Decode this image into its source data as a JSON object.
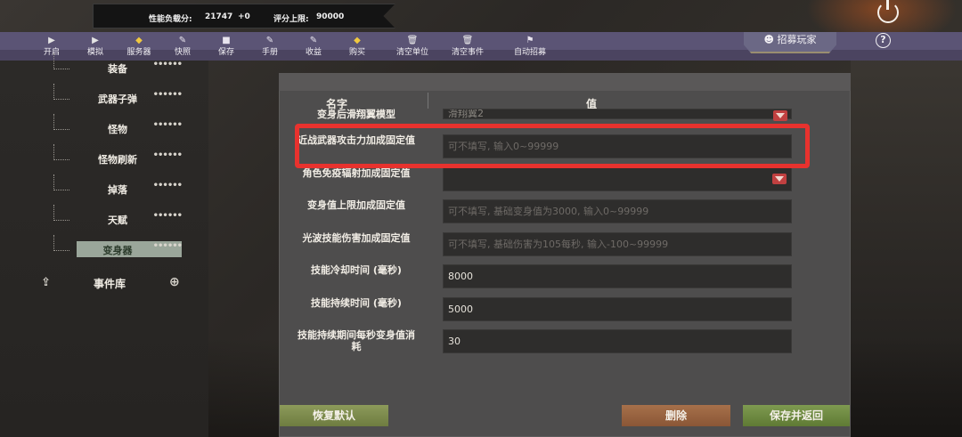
{
  "stats": {
    "load_label": "性能负载分:",
    "load_value": "21747",
    "load_delta": "+0",
    "score_label": "评分上限:",
    "score_value": "90000"
  },
  "toolbar": {
    "items": [
      {
        "label": "开启",
        "icon": "play-icon"
      },
      {
        "label": "模拟",
        "icon": "play-icon"
      },
      {
        "label": "服务器",
        "icon": "box-icon"
      },
      {
        "label": "快照",
        "icon": "edit-icon"
      },
      {
        "label": "保存",
        "icon": "file-icon"
      },
      {
        "label": "手册",
        "icon": "edit-icon"
      },
      {
        "label": "收益",
        "icon": "edit-icon"
      },
      {
        "label": "购买",
        "icon": "box-icon"
      },
      {
        "label": "清空单位",
        "icon": "trash-icon"
      },
      {
        "label": "清空事件",
        "icon": "trash-icon"
      },
      {
        "label": "自动招募",
        "icon": "flag-icon"
      }
    ],
    "recruit_label": "招募玩家",
    "help_label": "?"
  },
  "sidebar": {
    "items": [
      {
        "label": "装备",
        "dots": "••••••"
      },
      {
        "label": "武器子弹",
        "dots": "••••••"
      },
      {
        "label": "怪物",
        "dots": "••••••"
      },
      {
        "label": "怪物刷新",
        "dots": "••••••"
      },
      {
        "label": "掉落",
        "dots": "••••••"
      },
      {
        "label": "天赋",
        "dots": "••••••"
      },
      {
        "label": "变身器",
        "dots": "••••••",
        "active": true
      }
    ],
    "event_lib_label": "事件库"
  },
  "panel": {
    "col_name": "名字",
    "col_value": "值",
    "rows": [
      {
        "label": "变身后滑翔翼模型",
        "value": "滑翔翼2",
        "type": "dropdown"
      },
      {
        "label": "近战武器攻击力加成固定值",
        "value": "",
        "placeholder": "可不填写, 输入0~99999",
        "type": "input"
      },
      {
        "label": "角色免疫辐射加成固定值",
        "value": "",
        "type": "dropdown"
      },
      {
        "label": "变身值上限加成固定值",
        "value": "",
        "placeholder": "可不填写, 基础变身值为3000, 输入0~99999",
        "type": "input"
      },
      {
        "label": "光波技能伤害加成固定值",
        "value": "",
        "placeholder": "可不填写, 基础伤害为105每秒, 输入-100~99999",
        "type": "input"
      },
      {
        "label": "技能冷却时间 (毫秒)",
        "value": "8000",
        "type": "input"
      },
      {
        "label": "技能持续时间 (毫秒)",
        "value": "5000",
        "type": "input"
      },
      {
        "label": "技能持续期间每秒变身值消耗",
        "value": "30",
        "type": "input"
      }
    ]
  },
  "buttons": {
    "restore": "恢复默认",
    "delete": "删除",
    "save": "保存并返回"
  },
  "colors": {
    "toolbar": "#4b4460",
    "highlight": "#e8322e",
    "panel": "#4e4d4d"
  }
}
